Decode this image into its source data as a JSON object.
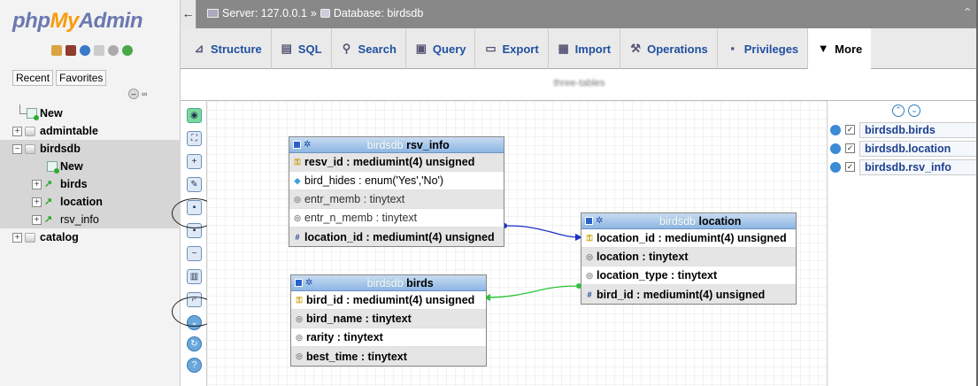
{
  "logo": {
    "php": "php",
    "my": "My",
    "admin": "Admin"
  },
  "nav": {
    "recent": "Recent",
    "favorites": "Favorites",
    "tree": [
      {
        "label": "New",
        "level": 0
      },
      {
        "label": "admintable",
        "level": 0
      },
      {
        "label": "birdsdb",
        "level": 0
      },
      {
        "label": "New",
        "level": 1
      },
      {
        "label": "birds",
        "level": 1
      },
      {
        "label": "location",
        "level": 1
      },
      {
        "label": "rsv_info",
        "level": 1
      },
      {
        "label": "catalog",
        "level": 0
      }
    ]
  },
  "breadcrumb": {
    "server": "Server: 127.0.0.1",
    "separator": "»",
    "database": "Database: birdsdb"
  },
  "menu": {
    "tabs": [
      {
        "label": "Structure",
        "icon": "structure-icon"
      },
      {
        "label": "SQL",
        "icon": "sql-icon"
      },
      {
        "label": "Search",
        "icon": "search-icon"
      },
      {
        "label": "Query",
        "icon": "query-icon"
      },
      {
        "label": "Export",
        "icon": "export-icon"
      },
      {
        "label": "Import",
        "icon": "import-icon"
      },
      {
        "label": "Operations",
        "icon": "wrench-icon"
      },
      {
        "label": "Privileges",
        "icon": "privileges-icon"
      },
      {
        "label": "More",
        "icon": "dropdown-triangle-icon"
      }
    ]
  },
  "page_name": "three-tables",
  "designer": {
    "tables": {
      "rsv_info": {
        "db": "birdsdb",
        "name": "rsv_info",
        "columns": [
          {
            "text": "resv_id : mediumint(4) unsigned",
            "icon": "key"
          },
          {
            "text": "bird_hides : enum('Yes','No')",
            "icon": "dot"
          },
          {
            "text": "entr_memb : tinytext",
            "icon": "circle"
          },
          {
            "text": "entr_n_memb : tinytext",
            "icon": "circle"
          },
          {
            "text": "location_id : mediumint(4) unsigned",
            "icon": "hash"
          }
        ]
      },
      "location": {
        "db": "birdsdb",
        "name": "location",
        "columns": [
          {
            "text": "location_id : mediumint(4) unsigned",
            "icon": "key"
          },
          {
            "text": "location : tinytext",
            "icon": "circle"
          },
          {
            "text": "location_type : tinytext",
            "icon": "circle"
          },
          {
            "text": "bird_id : mediumint(4) unsigned",
            "icon": "hash"
          }
        ]
      },
      "birds": {
        "db": "birdsdb",
        "name": "birds",
        "columns": [
          {
            "text": "bird_id : mediumint(4) unsigned",
            "icon": "key"
          },
          {
            "text": "bird_name : tinytext",
            "icon": "circle"
          },
          {
            "text": "rarity : tinytext",
            "icon": "circle"
          },
          {
            "text": "best_time : tinytext",
            "icon": "circle"
          }
        ]
      }
    },
    "relation_colors": {
      "rsv_to_location": "#1a2fc8",
      "location_to_birds": "#2bc43a"
    }
  },
  "right_panel": {
    "items": [
      "birdsdb.birds",
      "birdsdb.location",
      "birdsdb.rsv_info"
    ],
    "check": "✓"
  }
}
